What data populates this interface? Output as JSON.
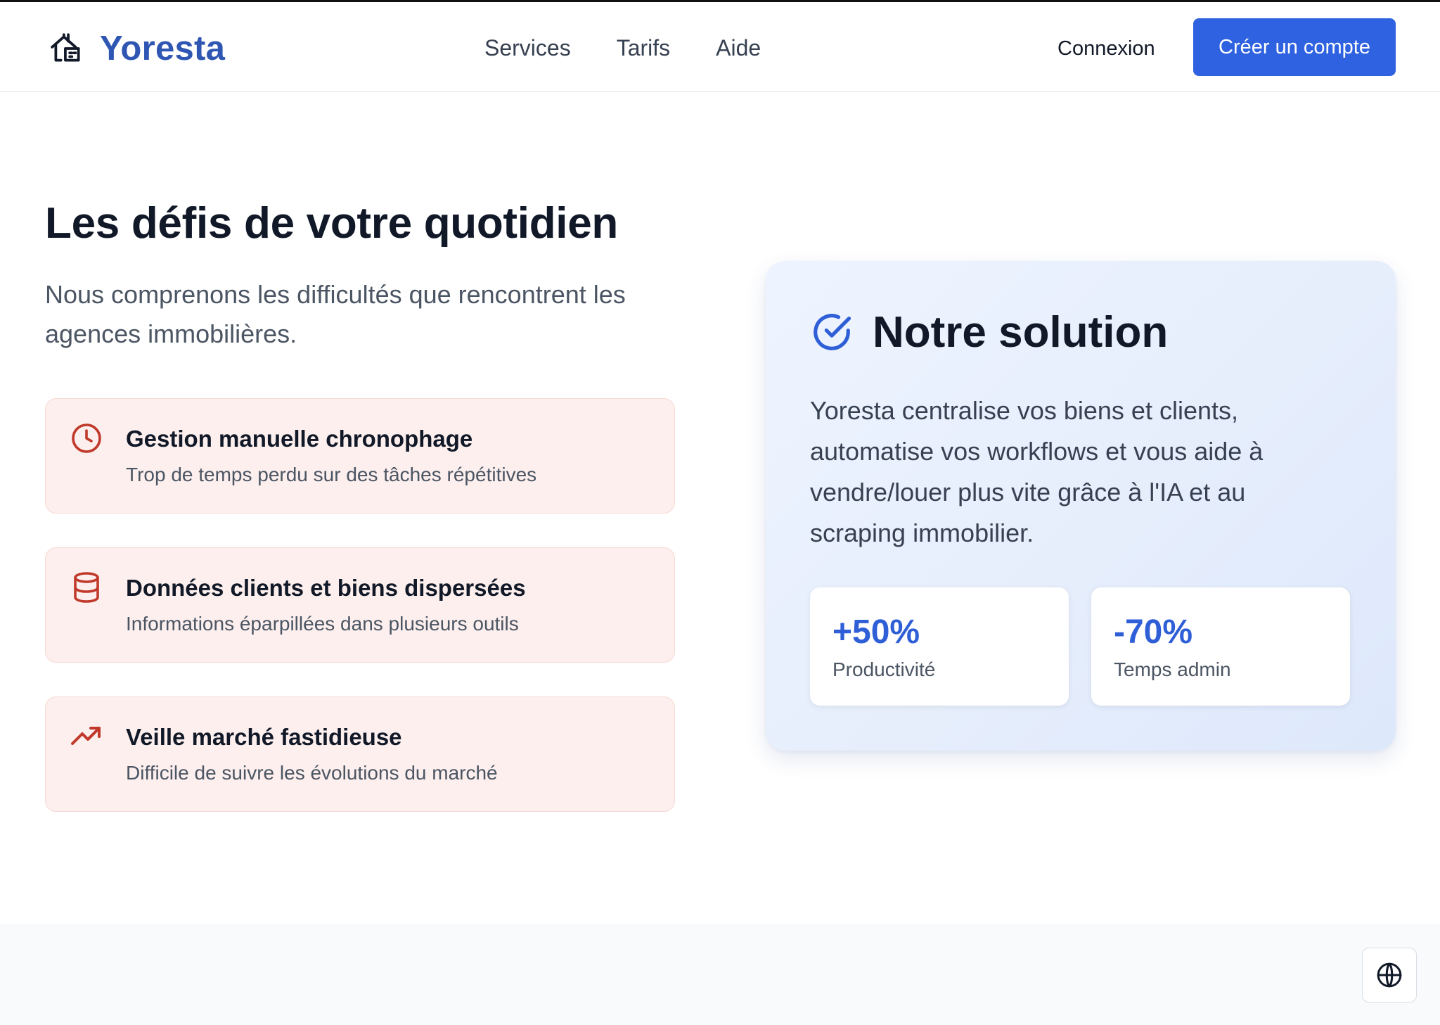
{
  "colors": {
    "brand": "#2f56b3",
    "cta": "#2f62e0",
    "accent_blue": "#2f5fd6",
    "problem_icon": "#c0392b",
    "problem_bg": "#fcefed"
  },
  "header": {
    "brand": "Yoresta",
    "logo_icon": "house-icon",
    "nav": [
      "Services",
      "Tarifs",
      "Aide"
    ],
    "login": "Connexion",
    "signup": "Créer un compte"
  },
  "challenges": {
    "title": "Les défis de votre quotidien",
    "intro": "Nous comprenons les difficultés que rencontrent les agences immobilières.",
    "items": [
      {
        "icon": "clock-icon",
        "title": "Gestion manuelle chronophage",
        "desc": "Trop de temps perdu sur des tâches répétitives"
      },
      {
        "icon": "database-icon",
        "title": "Données clients et biens dispersées",
        "desc": "Informations éparpillées dans plusieurs outils"
      },
      {
        "icon": "trending-up-icon",
        "title": "Veille marché fastidieuse",
        "desc": "Difficile de suivre les évolutions du marché"
      }
    ]
  },
  "solution": {
    "icon": "check-circle-icon",
    "title": "Notre solution",
    "desc": "Yoresta centralise vos biens et clients, automatise vos workflows et vous aide à vendre/louer plus vite grâce à l'IA et au scraping immobilier.",
    "stats": [
      {
        "value": "+50%",
        "label": "Productivité"
      },
      {
        "value": "-70%",
        "label": "Temps admin"
      }
    ]
  },
  "footer": {
    "lang_icon": "globe-icon"
  }
}
